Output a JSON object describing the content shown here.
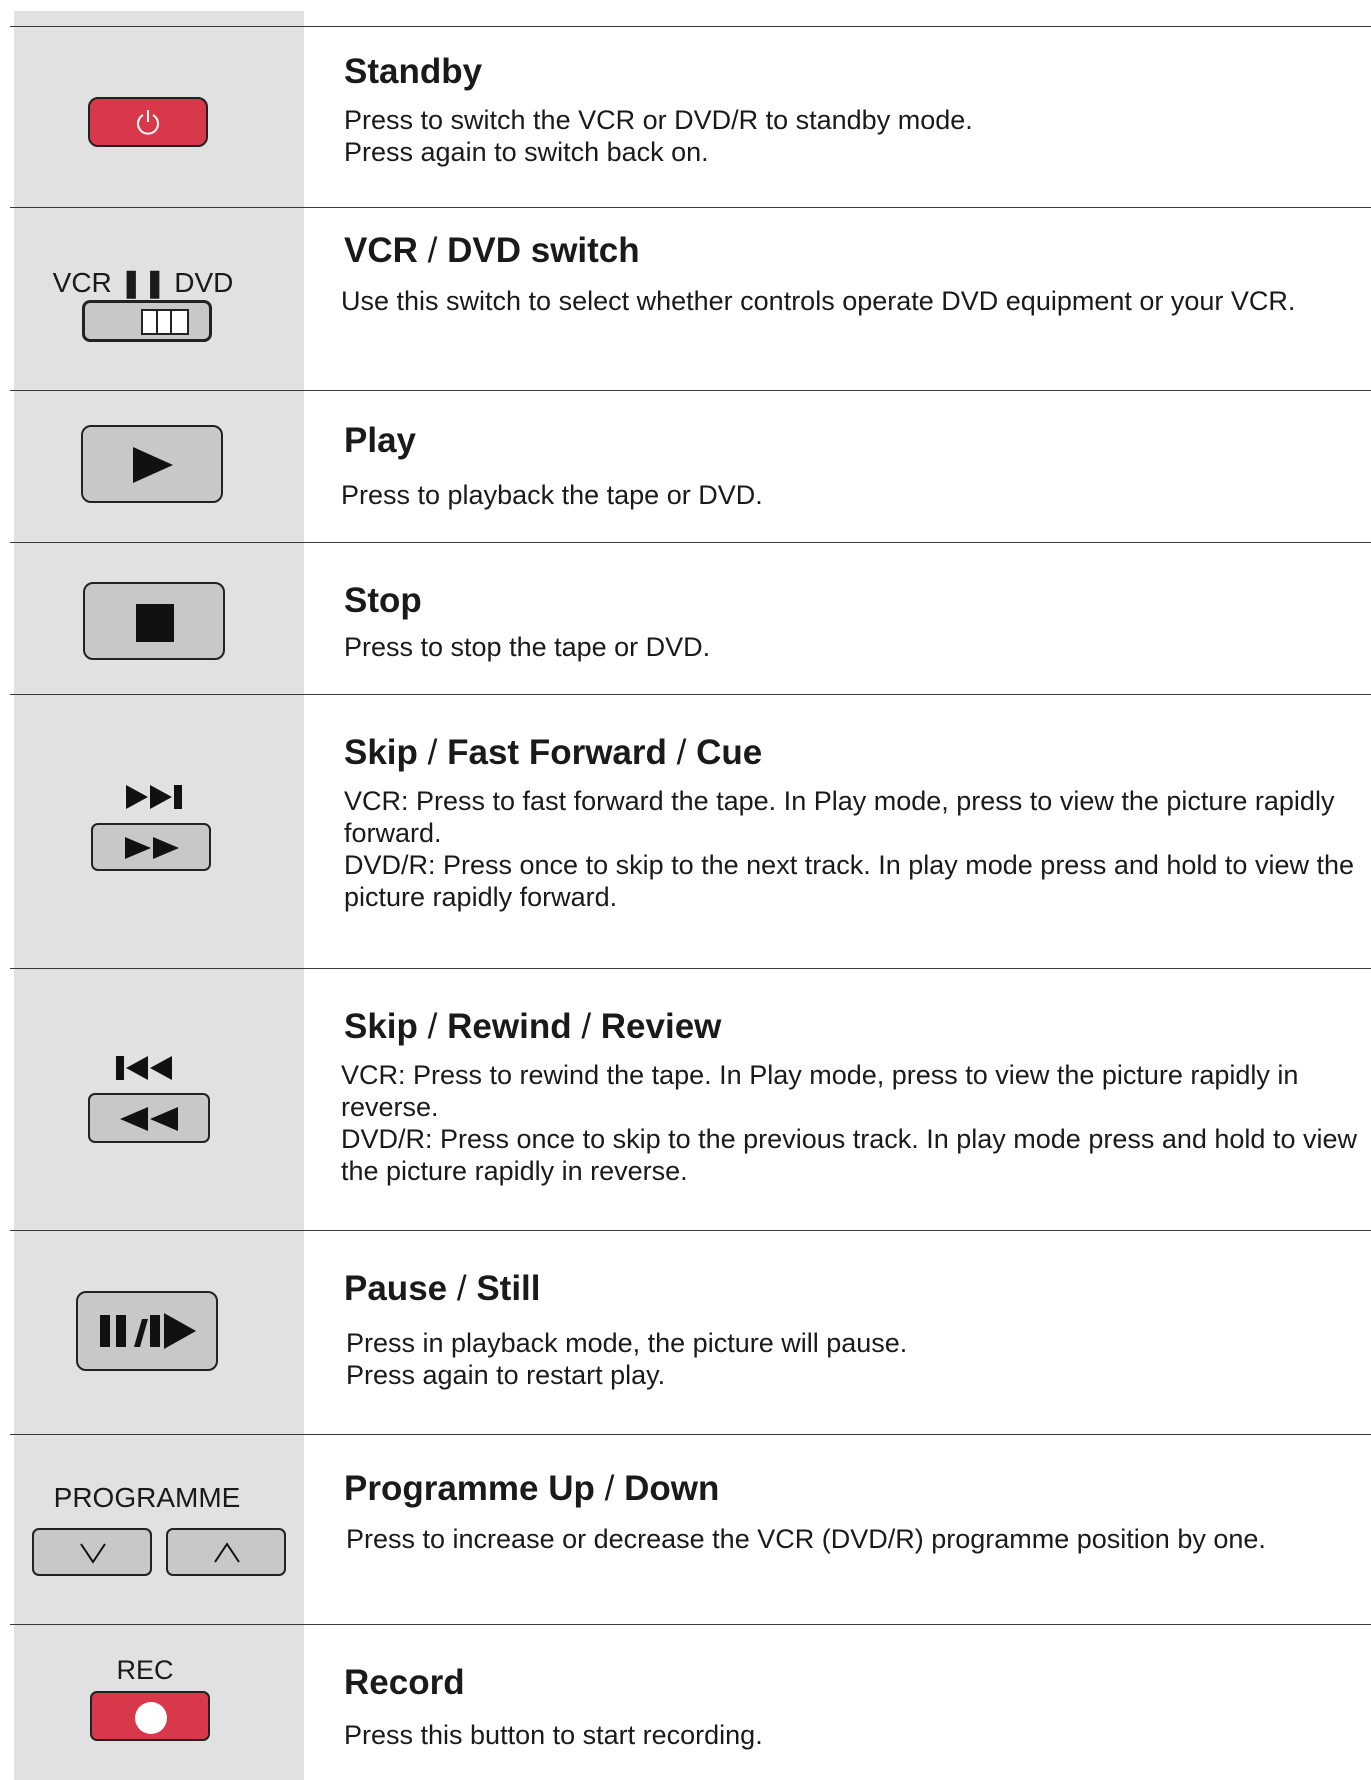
{
  "colors": {
    "icon_column": "#e1e1e1",
    "button_gray": "#c8c8c8",
    "button_red": "#d8394a",
    "rule": "#3a3a3a"
  },
  "sections": [
    {
      "icon": "power-icon",
      "title_parts": [
        "Standby"
      ],
      "desc": [
        "Press to switch the VCR or DVD/R to standby mode.",
        "Press again to switch back on."
      ]
    },
    {
      "icon": "vcr-dvd-slide-switch-icon",
      "label": "VCR ❚❚ DVD",
      "title_parts": [
        "VCR",
        "/",
        "DVD switch"
      ],
      "desc": [
        "Use this switch to select whether controls operate DVD equipment or your VCR."
      ]
    },
    {
      "icon": "play-icon",
      "title_parts": [
        "Play"
      ],
      "desc": [
        "Press to playback the tape or DVD."
      ]
    },
    {
      "icon": "stop-icon",
      "title_parts": [
        "Stop"
      ],
      "desc": [
        "Press to stop the tape or DVD."
      ]
    },
    {
      "icon": "fast-forward-icon",
      "title_parts": [
        "Skip",
        "/",
        "Fast Forward",
        "/",
        "Cue"
      ],
      "desc": [
        "VCR: Press to fast forward the tape. In Play mode, press to view the picture rapidly forward.",
        "DVD/R: Press once to skip to the next track.  In play mode press and hold to view the picture rapidly forward."
      ]
    },
    {
      "icon": "rewind-icon",
      "title_parts": [
        "Skip",
        "/",
        "Rewind",
        "/",
        "Review"
      ],
      "desc": [
        "VCR: Press to rewind the tape. In Play mode, press to view the picture rapidly in reverse.",
        "DVD/R: Press once to skip to the previous track.  In play mode press and hold to view the picture rapidly in reverse."
      ]
    },
    {
      "icon": "pause-still-icon",
      "title_parts": [
        "Pause",
        "/",
        "Still"
      ],
      "desc": [
        "Press in playback mode, the picture will pause.",
        "Press again to restart play."
      ]
    },
    {
      "icon": "programme-up-down-icon",
      "label": "PROGRAMME",
      "title_parts": [
        "Programme Up",
        "/",
        "Down"
      ],
      "desc": [
        "Press to increase or decrease the VCR (DVD/R) programme position by one."
      ]
    },
    {
      "icon": "record-icon",
      "label": "REC",
      "title_parts": [
        "Record"
      ],
      "desc": [
        "Press this button to start recording."
      ]
    }
  ]
}
